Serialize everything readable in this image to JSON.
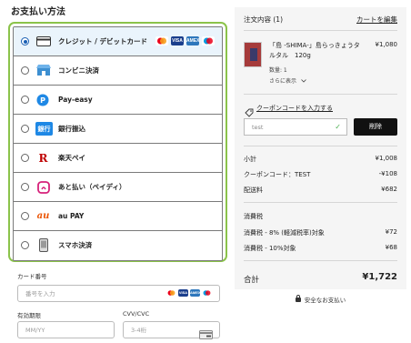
{
  "payment": {
    "title": "お支払い方法",
    "methods": [
      {
        "label": "クレジット / デビットカード",
        "icon": "credit-card-icon",
        "selected": true
      },
      {
        "label": "コンビニ決済",
        "icon": "convenience-store-icon",
        "selected": false
      },
      {
        "label": "Pay-easy",
        "icon": "pay-easy-icon",
        "selected": false
      },
      {
        "label": "銀行振込",
        "icon": "bank-transfer-icon",
        "selected": false
      },
      {
        "label": "楽天ペイ",
        "icon": "rakuten-pay-icon",
        "selected": false
      },
      {
        "label": "あと払い（ペイディ）",
        "icon": "paidy-icon",
        "selected": false
      },
      {
        "label": "au PAY",
        "icon": "au-pay-icon",
        "selected": false
      },
      {
        "label": "スマホ決済",
        "icon": "smartphone-payment-icon",
        "selected": false
      }
    ],
    "card_brands": [
      "MASTERCARD",
      "VISA",
      "AMEX",
      "MAESTRO"
    ],
    "icon_texts": {
      "bank": "銀行",
      "rakuten": "R",
      "au": "au"
    }
  },
  "card_form": {
    "number_label": "カード番号",
    "number_placeholder": "番号を入力",
    "expiry_label": "有効期限",
    "expiry_placeholder": "MM/YY",
    "cvv_label": "CVV/CVC",
    "cvv_placeholder": "3-4桁"
  },
  "summary": {
    "title": "注文内容 (1)",
    "edit_link": "カートを編集",
    "product": {
      "name": "「島 -SHIMA-」島らっきょうタルタル　120g",
      "price": "¥1,080",
      "quantity": "数量: 1",
      "more": "さらに表示"
    },
    "coupon_link": "クーポンコードを入力する",
    "coupon_value": "test",
    "delete_button": "削除",
    "rows": [
      {
        "label": "小計",
        "value": "¥1,008"
      },
      {
        "label": "クーポンコード：TEST",
        "value": "-¥108"
      },
      {
        "label": "配送料",
        "value": "¥682"
      }
    ],
    "tax_title": "消費税",
    "tax_rows": [
      {
        "label": "消費税 - 8% (軽減税率)対象",
        "value": "¥72"
      },
      {
        "label": "消費税 - 10%対象",
        "value": "¥68"
      }
    ],
    "total_label": "合計",
    "total_value": "¥1,722",
    "secure_text": "安全なお支払い"
  },
  "colors": {
    "accent_green": "#8bc34a",
    "selected_bg": "#eaf4fc",
    "radio_blue": "#1a5fb4"
  }
}
